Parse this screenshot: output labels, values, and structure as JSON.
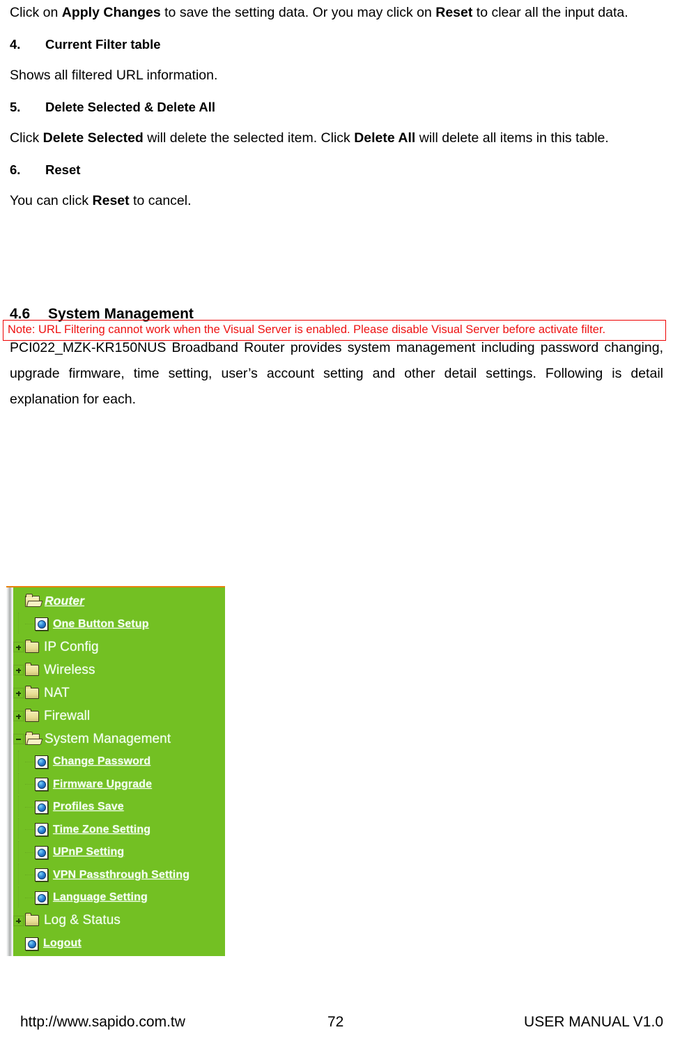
{
  "document": {
    "paragraphs": {
      "intro": {
        "pre": "Click on ",
        "bold1": "Apply Changes",
        "mid": " to save the setting data. Or you may click on ",
        "bold2": "Reset",
        "post": " to clear all the input data."
      },
      "shows_filtered": "Shows all filtered URL information.",
      "delete_desc": {
        "pre": "Click ",
        "bold1": "Delete Selected",
        "mid": " will delete the selected item. Click ",
        "bold2": "Delete All",
        "post": " will delete all items in this table."
      },
      "reset_desc": {
        "pre": "You can click ",
        "bold1": "Reset",
        "post": " to cancel."
      },
      "system_mgmt_body": "PCI022_MZK-KR150NUS Broadband Router provides system management including password changing, upgrade firmware, time setting, user’s account setting and other detail settings. Following is detail explanation for each."
    },
    "headings": {
      "item4": {
        "number": "4.",
        "text": "Current Filter table"
      },
      "item5": {
        "number": "5.",
        "text": "Delete Selected & Delete All"
      },
      "item6": {
        "number": "6.",
        "text": "Reset"
      },
      "section46": {
        "number": "4.6",
        "text": "System Management"
      }
    },
    "note": {
      "lead": "Note:",
      "body": " URL Filtering cannot work when the Visual Server is enabled. Please disable Visual Server before activate filter.",
      "border_color": "#ee0000",
      "text_color": "#ee1111"
    }
  },
  "tree_panel": {
    "background_color": "#73c023",
    "top_rule_color": "#e8820c",
    "label_color": "#f2fff0",
    "items": [
      {
        "label": "Router",
        "icon": "folder-open-icon",
        "expander": "none",
        "depth": 0,
        "style": "root"
      },
      {
        "label": "One Button Setup",
        "icon": "page-globe-icon",
        "expander": "stub",
        "depth": 1,
        "style": "link"
      },
      {
        "label": "IP Config",
        "icon": "folder-closed-icon",
        "expander": "plus",
        "depth": 0,
        "style": "plain"
      },
      {
        "label": "Wireless",
        "icon": "folder-closed-icon",
        "expander": "plus",
        "depth": 0,
        "style": "plain"
      },
      {
        "label": "NAT",
        "icon": "folder-closed-icon",
        "expander": "plus",
        "depth": 0,
        "style": "plain"
      },
      {
        "label": "Firewall",
        "icon": "folder-closed-icon",
        "expander": "plus",
        "depth": 0,
        "style": "plain"
      },
      {
        "label": "System Management",
        "icon": "folder-open-icon",
        "expander": "minus",
        "depth": 0,
        "style": "plain"
      },
      {
        "label": "Change Password",
        "icon": "page-globe-icon",
        "expander": "stub",
        "depth": 2,
        "style": "link"
      },
      {
        "label": "Firmware Upgrade",
        "icon": "page-globe-icon",
        "expander": "stub",
        "depth": 2,
        "style": "link"
      },
      {
        "label": "Profiles Save",
        "icon": "page-globe-icon",
        "expander": "stub",
        "depth": 2,
        "style": "link"
      },
      {
        "label": "Time Zone Setting",
        "icon": "page-globe-icon",
        "expander": "stub",
        "depth": 2,
        "style": "link"
      },
      {
        "label": "UPnP Setting",
        "icon": "page-globe-icon",
        "expander": "stub",
        "depth": 2,
        "style": "link"
      },
      {
        "label": "VPN Passthrough Setting",
        "icon": "page-globe-icon",
        "expander": "stub",
        "depth": 2,
        "style": "link"
      },
      {
        "label": "Language Setting",
        "icon": "page-globe-icon",
        "expander": "stub",
        "depth": 2,
        "style": "link"
      },
      {
        "label": "Log & Status",
        "icon": "folder-closed-icon",
        "expander": "plus",
        "depth": 0,
        "style": "plain"
      },
      {
        "label": "Logout",
        "icon": "page-globe-icon",
        "expander": "none",
        "depth": 0,
        "style": "link"
      }
    ]
  },
  "footer": {
    "url": "http://www.sapido.com.tw",
    "page_number": "72",
    "manual": "USER MANUAL V1.0"
  }
}
